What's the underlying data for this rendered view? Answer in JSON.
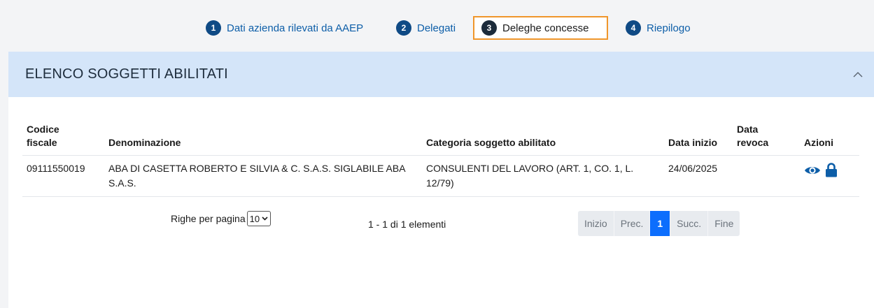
{
  "stepper": {
    "steps": [
      {
        "number": "1",
        "label": "Dati azienda rilevati da AAEP"
      },
      {
        "number": "2",
        "label": "Delegati"
      },
      {
        "number": "3",
        "label": "Deleghe concesse",
        "active": true
      },
      {
        "number": "4",
        "label": "Riepilogo"
      }
    ]
  },
  "panel": {
    "title": "ELENCO SOGGETTI ABILITATI",
    "collapse_icon": "chevron-up-icon"
  },
  "table": {
    "columns": {
      "codice_fiscale": [
        "Codice",
        "fiscale"
      ],
      "denominazione": "Denominazione",
      "categoria": "Categoria soggetto abilitato",
      "data_inizio": "Data inizio",
      "data_revoca": [
        "Data",
        "revoca"
      ],
      "azioni": "Azioni"
    },
    "rows": [
      {
        "codice_fiscale": "09111550019",
        "denominazione": "ABA DI CASETTA ROBERTO E SILVIA & C. S.A.S. SIGLABILE ABA S.A.S.",
        "categoria": "CONSULENTI DEL LAVORO (ART. 1, CO. 1, L. 12/79)",
        "data_inizio": "24/06/2025",
        "data_revoca": "",
        "actions": [
          "eye-icon",
          "lock-icon"
        ]
      }
    ]
  },
  "footer": {
    "rows_per_page_label": "Righe per pagina",
    "rows_per_page_value": "10",
    "count_text": "1 - 1 di 1 elementi",
    "pagination": {
      "first": "Inizio",
      "prev": "Prec.",
      "current": "1",
      "next": "Succ.",
      "last": "Fine"
    }
  },
  "colors": {
    "accent": "#0d6efd",
    "step_circle": "#0f4a85",
    "active_border": "#f0962b",
    "header_bg": "#d4e5f9"
  }
}
